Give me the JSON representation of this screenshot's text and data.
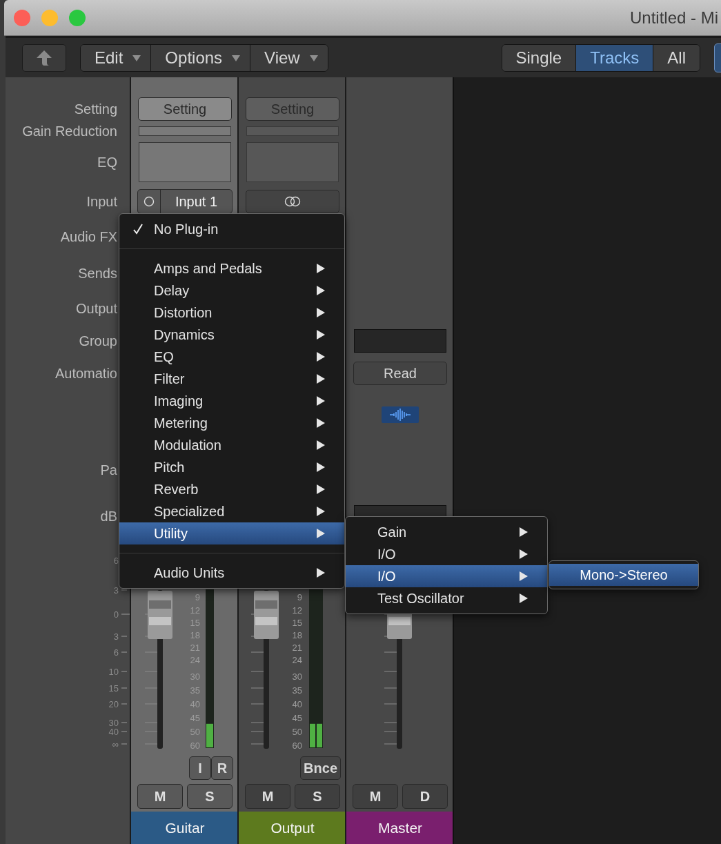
{
  "window": {
    "title": "Untitled - Mi"
  },
  "toolbar": {
    "menus": [
      "Edit",
      "Options",
      "View"
    ],
    "view_tabs": [
      {
        "label": "Single",
        "selected": false
      },
      {
        "label": "Tracks",
        "selected": true
      },
      {
        "label": "All",
        "selected": false
      }
    ]
  },
  "labels": [
    "Setting",
    "Gain Reduction",
    "EQ",
    "Input",
    "Audio FX",
    "Sends",
    "Output",
    "Group",
    "Automatio",
    "Pa",
    "dB"
  ],
  "scale": [
    "6",
    "3",
    "0",
    "3",
    "6",
    "10",
    "15",
    "20",
    "30",
    "40",
    "∞"
  ],
  "strips": [
    {
      "name": "Guitar",
      "color": "#2b5a86",
      "selected": true,
      "setting": "Setting",
      "input": {
        "kind": "mono",
        "label": "Input 1"
      },
      "meter_scale": [
        "9",
        "12",
        "15",
        "18",
        "21",
        "24",
        "30",
        "35",
        "40",
        "45",
        "50",
        "60"
      ],
      "meters": [
        {
          "level": 0.15
        }
      ],
      "buttons": [
        "I",
        "R"
      ],
      "bottom_buttons": [
        "M",
        "S"
      ]
    },
    {
      "name": "Output",
      "color": "#5d7a1e",
      "selected": false,
      "setting": "Setting",
      "input": {
        "kind": "stereo"
      },
      "meter_scale": [
        "9",
        "12",
        "15",
        "18",
        "21",
        "24",
        "30",
        "35",
        "40",
        "45",
        "50",
        "60"
      ],
      "meters": [
        {
          "level": 0.15
        },
        {
          "level": 0.15
        }
      ],
      "buttons": [
        "Bnce"
      ],
      "bottom_buttons": [
        "M",
        "S"
      ]
    },
    {
      "name": "Master",
      "color": "#7a1f6e",
      "selected": false,
      "automation": "Read",
      "bottom_buttons": [
        "M",
        "D"
      ]
    }
  ],
  "plugin_menu": {
    "items": [
      {
        "kind": "item",
        "label": "No Plug-in",
        "checked": true,
        "selected": false,
        "submenu": false
      },
      {
        "kind": "separator"
      },
      {
        "kind": "item",
        "label": "Amps and Pedals",
        "checked": false,
        "selected": false,
        "submenu": true
      },
      {
        "kind": "item",
        "label": "Delay",
        "checked": false,
        "selected": false,
        "submenu": true
      },
      {
        "kind": "item",
        "label": "Distortion",
        "checked": false,
        "selected": false,
        "submenu": true
      },
      {
        "kind": "item",
        "label": "Dynamics",
        "checked": false,
        "selected": false,
        "submenu": true
      },
      {
        "kind": "item",
        "label": "EQ",
        "checked": false,
        "selected": false,
        "submenu": true
      },
      {
        "kind": "item",
        "label": "Filter",
        "checked": false,
        "selected": false,
        "submenu": true
      },
      {
        "kind": "item",
        "label": "Imaging",
        "checked": false,
        "selected": false,
        "submenu": true
      },
      {
        "kind": "item",
        "label": "Metering",
        "checked": false,
        "selected": false,
        "submenu": true
      },
      {
        "kind": "item",
        "label": "Modulation",
        "checked": false,
        "selected": false,
        "submenu": true
      },
      {
        "kind": "item",
        "label": "Pitch",
        "checked": false,
        "selected": false,
        "submenu": true
      },
      {
        "kind": "item",
        "label": "Reverb",
        "checked": false,
        "selected": false,
        "submenu": true
      },
      {
        "kind": "item",
        "label": "Specialized",
        "checked": false,
        "selected": false,
        "submenu": true
      },
      {
        "kind": "item",
        "label": "Utility",
        "checked": false,
        "selected": true,
        "submenu": true
      },
      {
        "kind": "separator"
      },
      {
        "kind": "item",
        "label": "Audio Units",
        "checked": false,
        "selected": false,
        "submenu": true
      }
    ]
  },
  "utility_submenu": {
    "items": [
      {
        "label": "Gain",
        "selected": false,
        "submenu": true
      },
      {
        "label": "I/O",
        "selected": false,
        "submenu": true
      },
      {
        "label": "I/O",
        "selected": true,
        "submenu": true
      },
      {
        "label": "Test Oscillator",
        "selected": false,
        "submenu": true
      }
    ]
  },
  "io_submenu": {
    "items": [
      {
        "label": "Mono->Stereo",
        "selected": true,
        "submenu": false
      }
    ]
  }
}
